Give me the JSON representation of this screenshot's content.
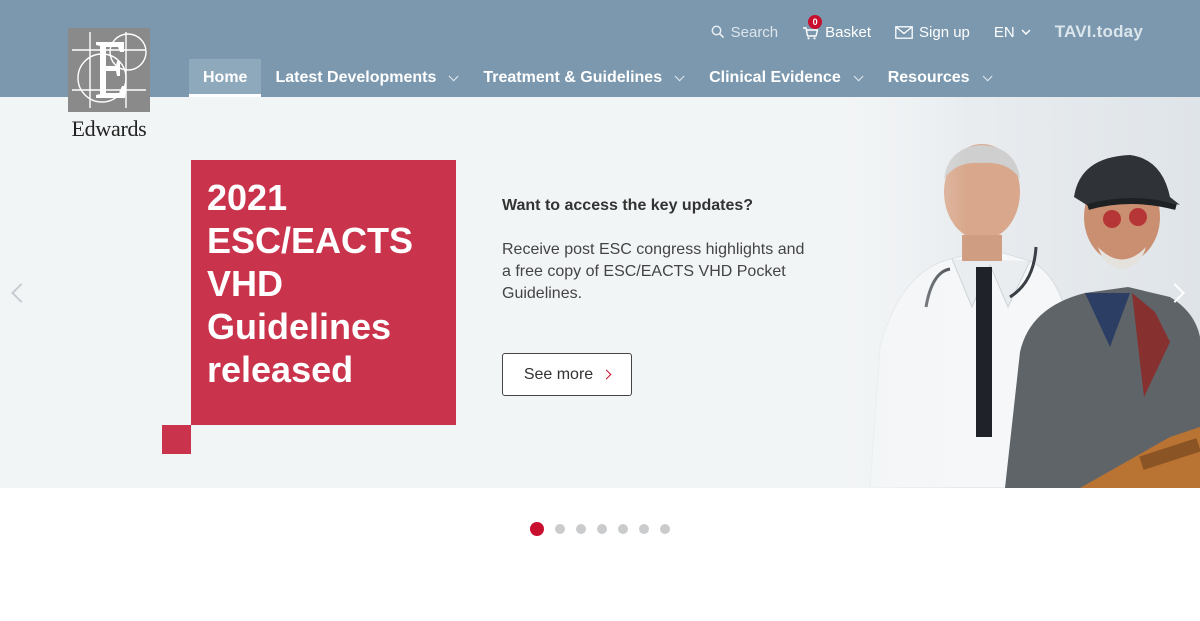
{
  "logo": {
    "text": "Edwards"
  },
  "topbar": {
    "search_label": "Search",
    "basket_label": "Basket",
    "basket_count": "0",
    "signup_label": "Sign up",
    "language": "EN",
    "brand": "TAVI.today"
  },
  "nav": {
    "items": [
      {
        "label": "Home"
      },
      {
        "label": "Latest Developments"
      },
      {
        "label": "Treatment & Guidelines"
      },
      {
        "label": "Clinical Evidence"
      },
      {
        "label": "Resources"
      }
    ]
  },
  "hero": {
    "title": "2021 ESC/EACTS VHD Guidelines released",
    "question": "Want to access the key updates?",
    "description": "Receive post ESC congress highlights and a free copy of ESC/EACTS VHD Pocket Guidelines.",
    "button_label": "See more"
  },
  "carousel": {
    "slide_count": 7,
    "active_index": 0
  },
  "colors": {
    "header": "#7b98ae",
    "accent": "#c8102e",
    "hero_red": "#ca334c",
    "hero_bg": "#f2f5f6"
  }
}
